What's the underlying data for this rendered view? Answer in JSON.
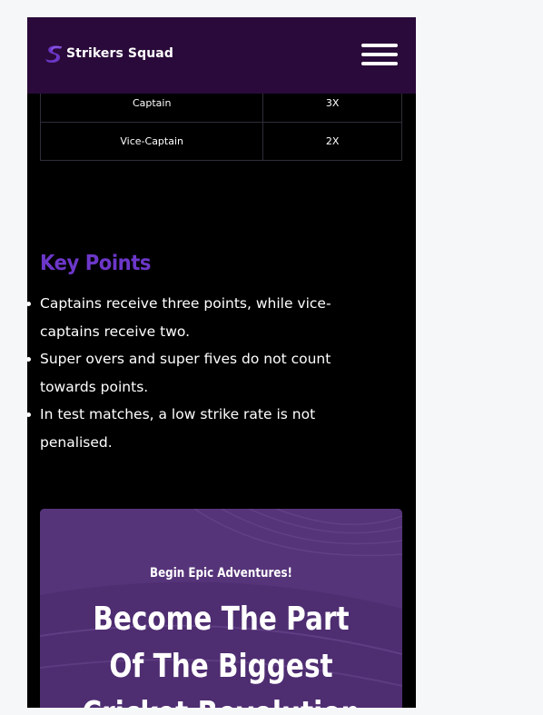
{
  "header": {
    "brand": "Strikers Squad",
    "logo_icon": "s-logo-icon",
    "menu_icon": "hamburger-menu-icon"
  },
  "points_table": {
    "rows": [
      {
        "role": "Captain",
        "multiplier": "3X"
      },
      {
        "role": "Vice-Captain",
        "multiplier": "2X"
      }
    ]
  },
  "key_points": {
    "heading": "Key Points",
    "items": [
      "Captains receive three points, while vice-captains receive two.",
      "Super overs and super fives do not count towards points.",
      "In test matches, a low strike rate is not penalised."
    ]
  },
  "promo": {
    "kicker": "Begin Epic Adventures!",
    "title_lines": [
      "Become The Part",
      "Of The Biggest",
      "Cricket Revolution"
    ]
  },
  "colors": {
    "header_bg": "#2a0a3a",
    "accent": "#6c37c9",
    "promo_bg": "#553379",
    "page_bg": "#000000"
  }
}
